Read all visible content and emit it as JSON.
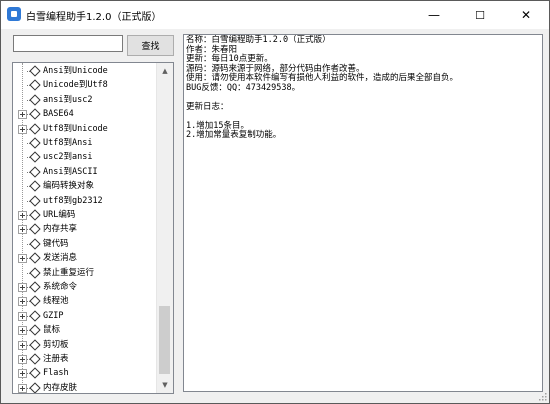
{
  "window": {
    "title": "白雪编程助手1.2.0（正式版）",
    "controls": {
      "minimize": "—",
      "maximize": "☐",
      "close": "✕"
    }
  },
  "search": {
    "value": "",
    "placeholder": "",
    "button_label": "查找"
  },
  "tree": {
    "items": [
      {
        "label": "Ansi到Unicode",
        "expandable": false
      },
      {
        "label": "Unicode到Utf8",
        "expandable": false
      },
      {
        "label": "ansi到usc2",
        "expandable": false
      },
      {
        "label": "BASE64",
        "expandable": true
      },
      {
        "label": "Utf8到Unicode",
        "expandable": true
      },
      {
        "label": "Utf8到Ansi",
        "expandable": false
      },
      {
        "label": "usc2到ansi",
        "expandable": false
      },
      {
        "label": "Ansi到ASCII",
        "expandable": false
      },
      {
        "label": "编码转换对象",
        "expandable": false
      },
      {
        "label": "utf8到gb2312",
        "expandable": false
      },
      {
        "label": "URL编码",
        "expandable": true
      },
      {
        "label": "内存共享",
        "expandable": true
      },
      {
        "label": "键代码",
        "expandable": false
      },
      {
        "label": "发送消息",
        "expandable": true
      },
      {
        "label": "禁止重复运行",
        "expandable": false
      },
      {
        "label": "系统命令",
        "expandable": true
      },
      {
        "label": "线程池",
        "expandable": true
      },
      {
        "label": "GZIP",
        "expandable": true
      },
      {
        "label": "鼠标",
        "expandable": true
      },
      {
        "label": "剪切板",
        "expandable": true
      },
      {
        "label": "注册表",
        "expandable": true
      },
      {
        "label": "Flash",
        "expandable": true
      },
      {
        "label": "内存皮肤",
        "expandable": true
      }
    ]
  },
  "content": {
    "text": "名称：白雪编程助手1.2.0（正式版）\n作者：朱春阳\n更新：每日10点更新。\n源码：源码来源于网络，部分代码由作者改善。\n使用：请勿使用本软件编写有损他人利益的软件，造成的后果全部自负。\nBUG反馈：QQ：473429538。\n\n更新日志：\n\n1.增加15条目。\n2.增加常量表复制功能。"
  }
}
